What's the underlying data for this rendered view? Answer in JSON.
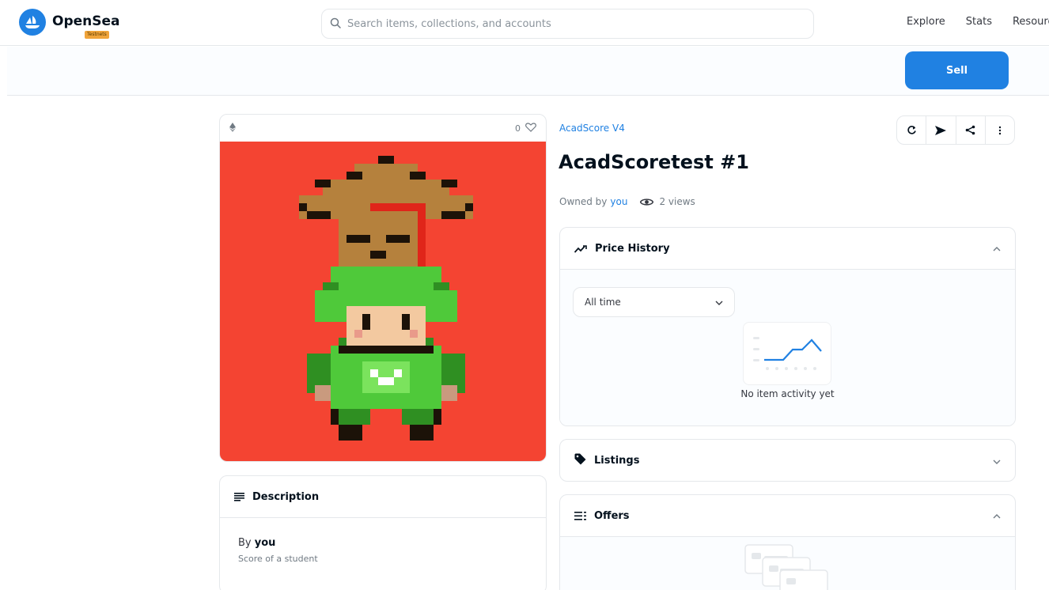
{
  "brand": {
    "name": "OpenSea",
    "badge": "Testnets"
  },
  "search": {
    "placeholder": "Search items, collections, and accounts"
  },
  "nav": {
    "links": [
      "Explore",
      "Stats",
      "Resources"
    ]
  },
  "actions": {
    "sell_label": "Sell"
  },
  "item": {
    "favorites": "0",
    "collection": "AcadScore V4",
    "title": "AcadScoretest #1",
    "owned_prefix": "Owned by",
    "owner": "you",
    "views": "2 views"
  },
  "description": {
    "title": "Description",
    "by_prefix": "By",
    "author": "you",
    "text": "Score of a student"
  },
  "price_history": {
    "title": "Price History",
    "range_selected": "All time",
    "empty_text": "No item activity yet"
  },
  "listings": {
    "title": "Listings"
  },
  "offers": {
    "title": "Offers"
  },
  "colors": {
    "accent": "#2081e2",
    "art_background": "#f44432",
    "badge": "#f0a43a"
  },
  "icons": {
    "logo": "opensea-boat-icon",
    "search": "search-icon",
    "eth": "ethereum-icon",
    "favorite": "heart-icon",
    "refresh": "refresh-icon",
    "transfer": "send-icon",
    "share": "share-icon",
    "more": "more-vertical-icon",
    "views": "eye-icon",
    "price": "trend-icon",
    "listings": "tag-icon",
    "offers": "list-icon",
    "description": "text-lines-icon",
    "expand": "chevron-icon"
  }
}
